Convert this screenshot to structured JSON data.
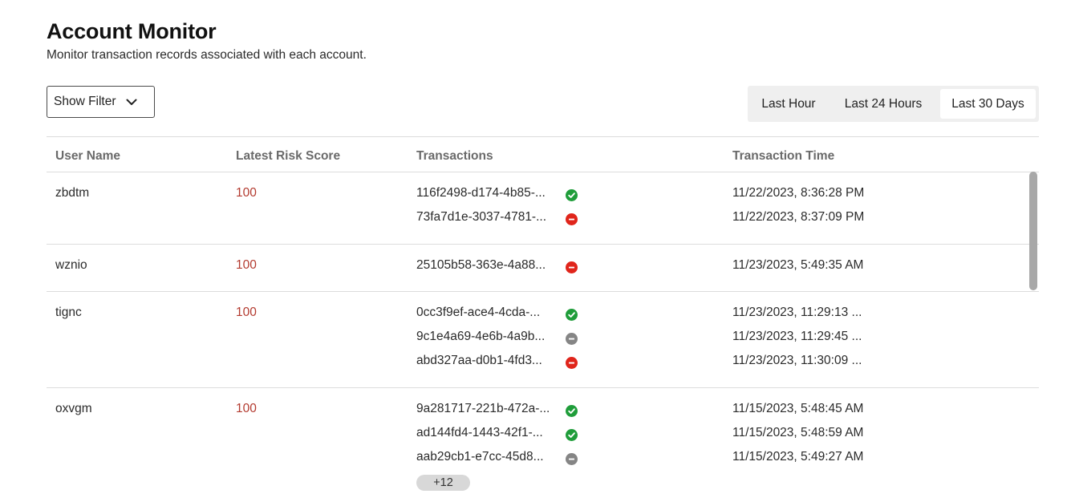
{
  "page": {
    "title": "Account Monitor",
    "subtitle": "Monitor transaction records associated with each account."
  },
  "filter": {
    "label": "Show Filter",
    "icon": "chevron-down-icon"
  },
  "time_range": {
    "options": [
      "Last Hour",
      "Last 24 Hours",
      "Last 30 Days"
    ],
    "selected": "Last 30 Days"
  },
  "table": {
    "headers": [
      "User Name",
      "Latest Risk Score",
      "Transactions",
      "Transaction Time"
    ],
    "rows": [
      {
        "user": "zbdtm",
        "risk": "100",
        "transactions": [
          {
            "id": "116f2498-d174-4b85-...",
            "status": "success"
          },
          {
            "id": "73fa7d1e-3037-4781-...",
            "status": "blocked"
          }
        ],
        "times": [
          "11/22/2023, 8:36:28 PM",
          "11/22/2023, 8:37:09 PM"
        ]
      },
      {
        "user": "wznio",
        "risk": "100",
        "transactions": [
          {
            "id": "25105b58-363e-4a88...",
            "status": "blocked"
          }
        ],
        "times": [
          "11/23/2023, 5:49:35 AM"
        ]
      },
      {
        "user": "tignc",
        "risk": "100",
        "transactions": [
          {
            "id": "0cc3f9ef-ace4-4cda-...",
            "status": "success"
          },
          {
            "id": "9c1e4a69-4e6b-4a9b...",
            "status": "neutral"
          },
          {
            "id": "abd327aa-d0b1-4fd3...",
            "status": "blocked"
          }
        ],
        "times": [
          "11/23/2023, 11:29:13 ...",
          "11/23/2023, 11:29:45 ...",
          "11/23/2023, 11:30:09 ..."
        ]
      },
      {
        "user": "oxvgm",
        "risk": "100",
        "transactions": [
          {
            "id": "9a281717-221b-472a-...",
            "status": "success"
          },
          {
            "id": "ad144fd4-1443-42f1-...",
            "status": "success"
          },
          {
            "id": "aab29cb1-e7cc-45d8...",
            "status": "neutral"
          }
        ],
        "more": "+12",
        "times": [
          "11/15/2023, 5:48:45 AM",
          "11/15/2023, 5:48:59 AM",
          "11/15/2023, 5:49:27 AM"
        ]
      }
    ]
  },
  "colors": {
    "success": "#1f9d3a",
    "blocked": "#e0251b",
    "neutral": "#858585",
    "risk": "#b33a2f"
  }
}
